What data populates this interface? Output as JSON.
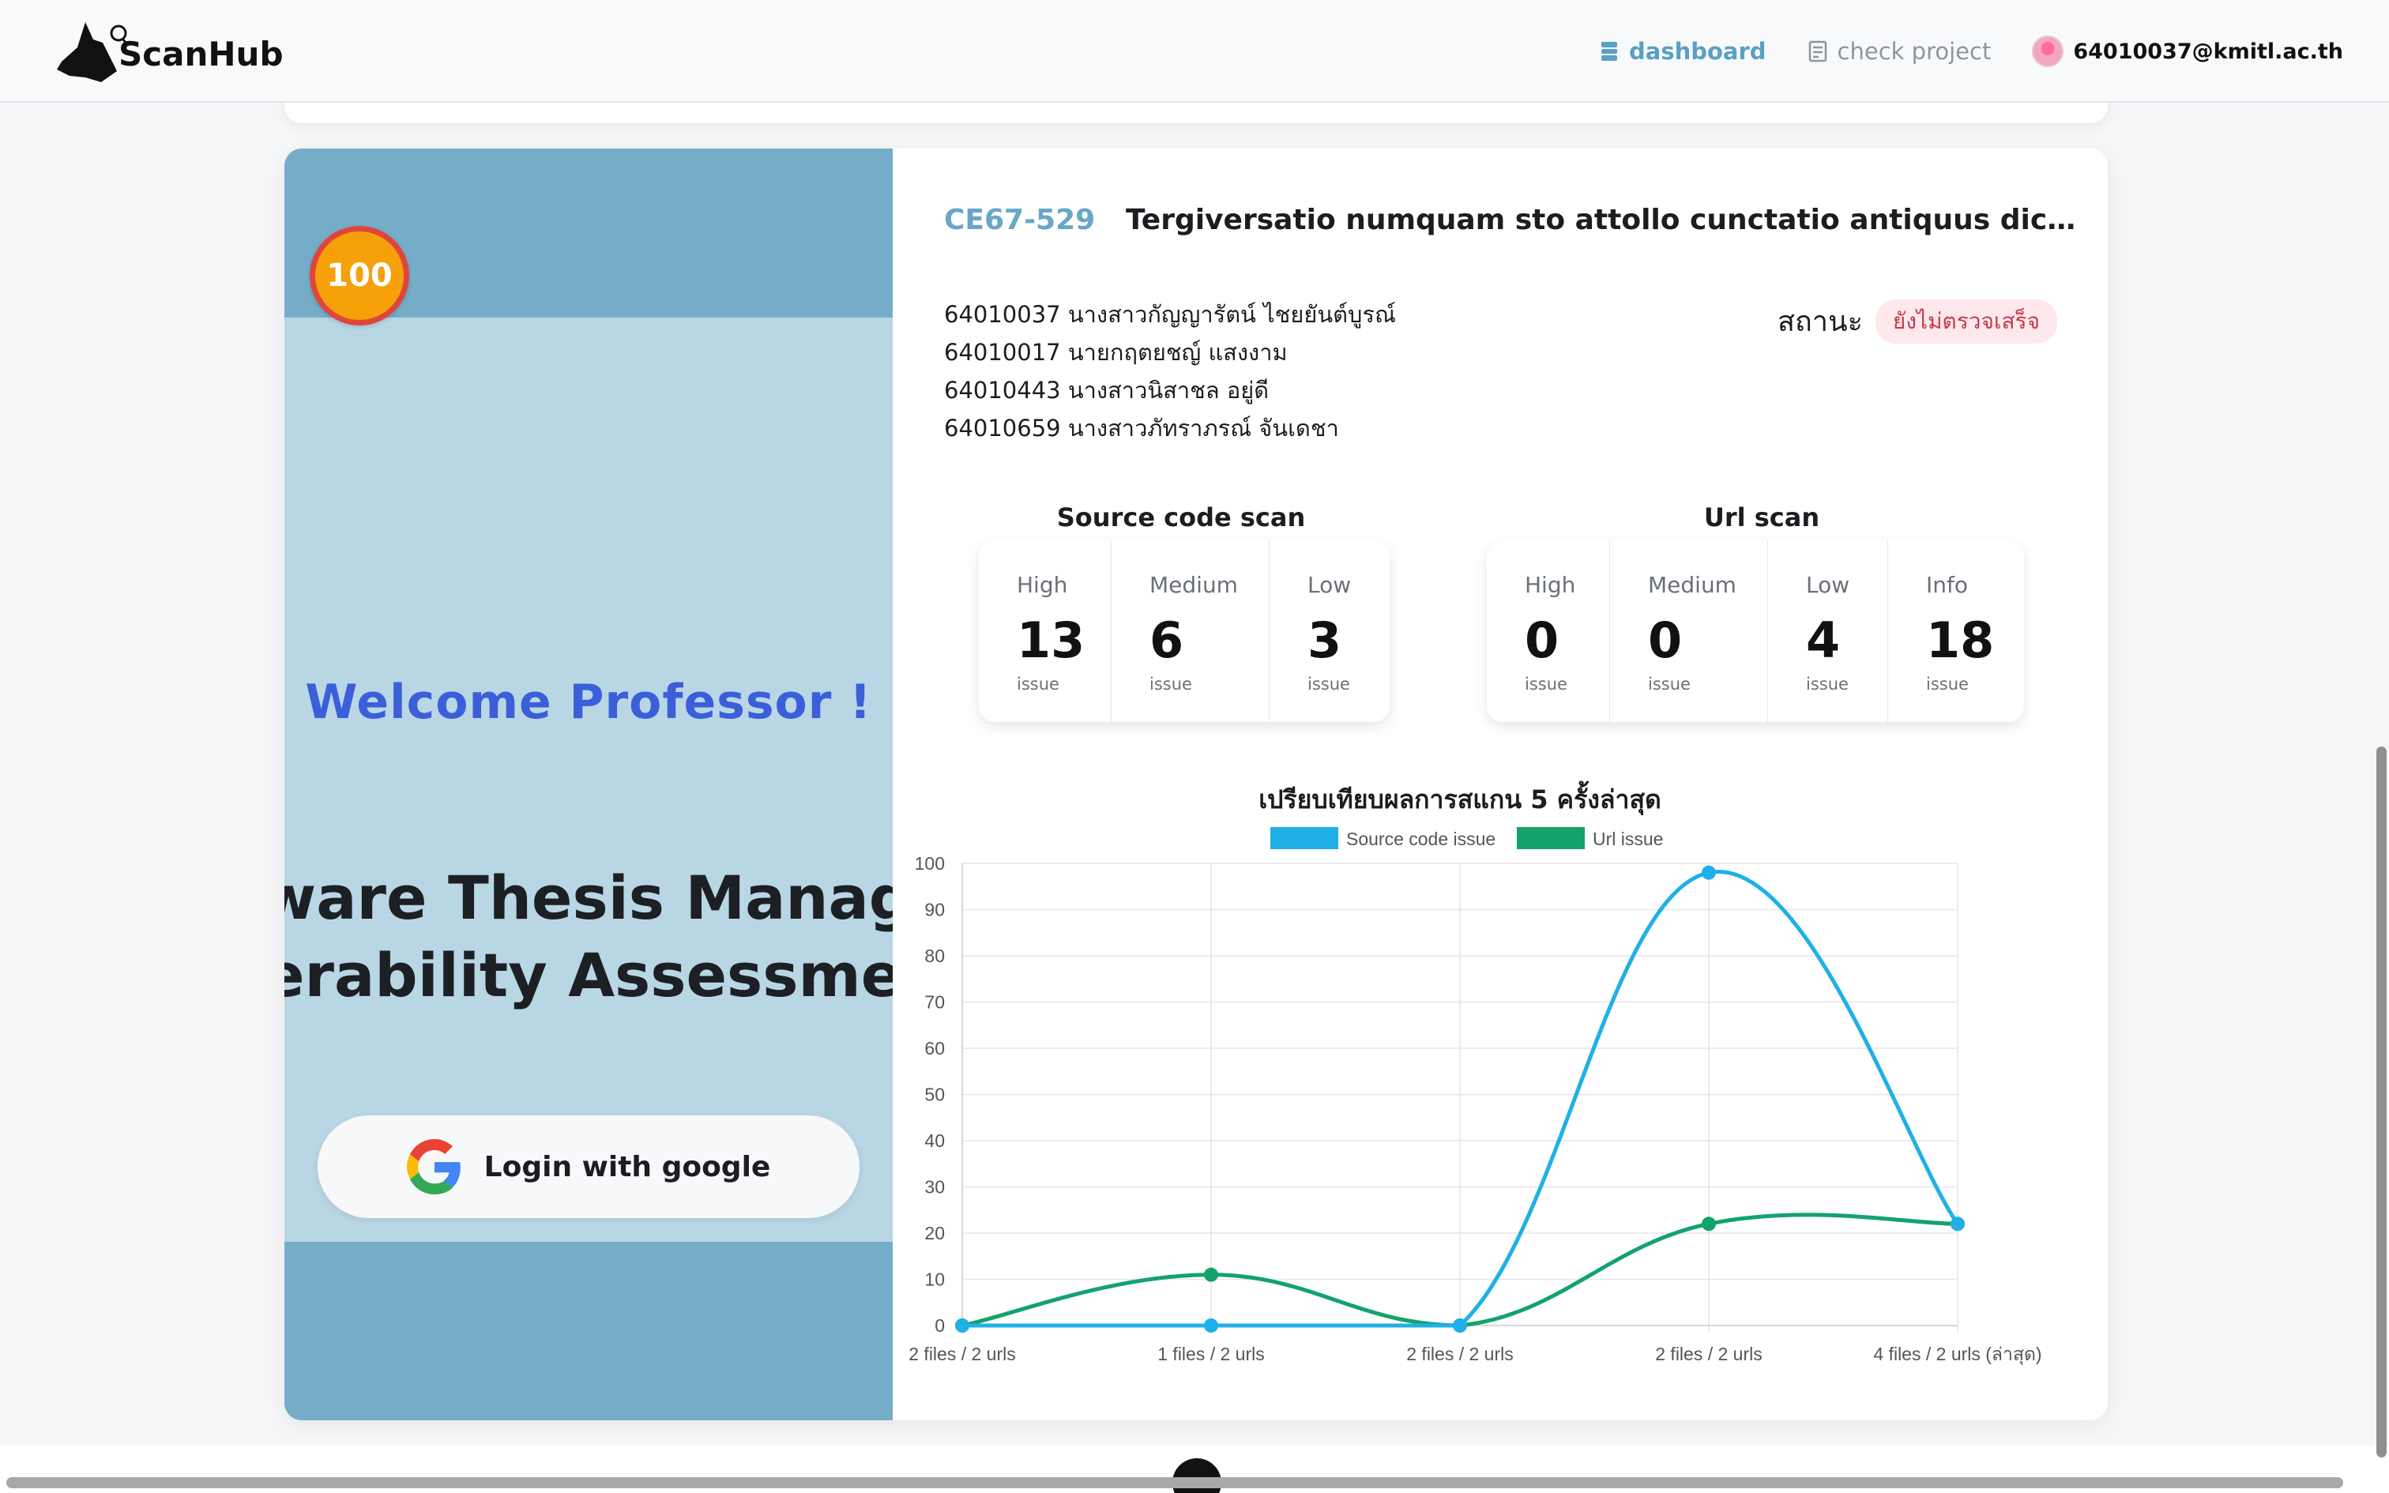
{
  "brand": {
    "name": "ScanHub",
    "icon": "dog-head-magnifier-logo"
  },
  "nav": {
    "dashboard": "dashboard",
    "check_project": "check project",
    "user_email": "64010037@kmitl.ac.th"
  },
  "preview": {
    "score": "100",
    "welcome": "Welcome Professor !",
    "line1": "ware Thesis Managem",
    "line2": "erability Assessment",
    "login": "Login with google"
  },
  "project": {
    "code": "CE67-529",
    "title": "Tergiversatio numquam sto attollo cunctatio antiquus dicta callid...",
    "members": [
      "64010037 นางสาวกัญญารัตน์ ไชยยันต์บูรณ์",
      "64010017 นายกฤตยชญ์ แสงงาม",
      "64010443 นางสาวนิสาชล อยู่ดี",
      "64010659 นางสาวภัทราภรณ์ จันเดชา"
    ],
    "status_label": "สถานะ",
    "status_value": "ยังไม่ตรวจเสร็จ"
  },
  "source_scan": {
    "title": "Source code scan",
    "items": [
      {
        "level": "High",
        "count": "13",
        "unit": "issue"
      },
      {
        "level": "Medium",
        "count": "6",
        "unit": "issue"
      },
      {
        "level": "Low",
        "count": "3",
        "unit": "issue"
      }
    ]
  },
  "url_scan": {
    "title": "Url scan",
    "items": [
      {
        "level": "High",
        "count": "0",
        "unit": "issue"
      },
      {
        "level": "Medium",
        "count": "0",
        "unit": "issue"
      },
      {
        "level": "Low",
        "count": "4",
        "unit": "issue"
      },
      {
        "level": "Info",
        "count": "18",
        "unit": "issue"
      }
    ]
  },
  "chart_data": {
    "type": "line",
    "title": "เปรียบเทียบผลการสแกน 5 ครั้งล่าสุด",
    "categories": [
      "2 files / 2 urls",
      "1 files / 2 urls",
      "2 files / 2 urls",
      "2 files / 2 urls",
      "4 files / 2 urls (ล่าสุด)"
    ],
    "series": [
      {
        "name": "Source code issue",
        "values": [
          0,
          0,
          0,
          98,
          22
        ],
        "color": "#1fb0e8"
      },
      {
        "name": "Url issue",
        "values": [
          0,
          11,
          0,
          22,
          22
        ],
        "color": "#12a36b"
      }
    ],
    "ylim": [
      0,
      100
    ],
    "yticks": [
      "0",
      "10",
      "20",
      "30",
      "40",
      "50",
      "60",
      "70",
      "80",
      "90",
      "100"
    ],
    "grid": true,
    "legend": "top"
  }
}
